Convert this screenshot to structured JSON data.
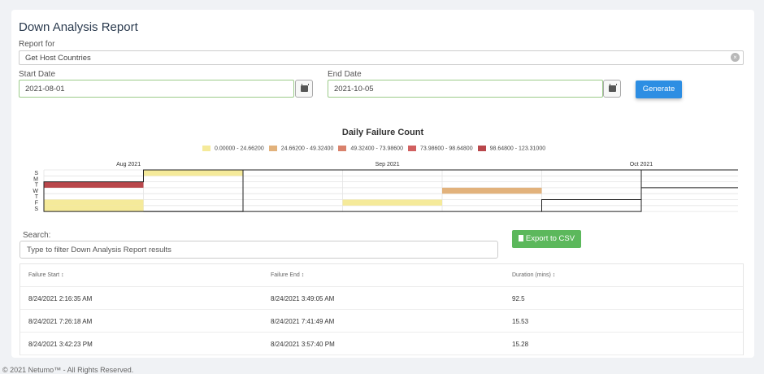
{
  "page": {
    "title": "Down Analysis Report"
  },
  "report_for": {
    "label": "Report for",
    "value": "Get Host Countries",
    "clear_icon": "times-circle-icon"
  },
  "start_date": {
    "label": "Start Date",
    "value": "2021-08-01"
  },
  "end_date": {
    "label": "End Date",
    "value": "2021-10-05"
  },
  "generate": {
    "label": "Generate"
  },
  "chart_data": {
    "type": "heatmap",
    "title": "Daily Failure Count",
    "legend": [
      {
        "label": "0.00000 - 24.66200",
        "color": "#f5ea9a"
      },
      {
        "label": "24.66200 - 49.32400",
        "color": "#e2b27c"
      },
      {
        "label": "49.32400 - 73.98600",
        "color": "#d9826c"
      },
      {
        "label": "73.98600 - 98.64800",
        "color": "#d16060"
      },
      {
        "label": "98.64800 - 123.31000",
        "color": "#b9474b"
      }
    ],
    "month_labels": [
      "Aug 2021",
      "Sep 2021",
      "Oct 2021"
    ],
    "weekday_labels": [
      "S",
      "M",
      "T",
      "W",
      "T",
      "F",
      "S"
    ],
    "legend_position": "top-center",
    "cells": [
      {
        "week": 0,
        "day": 2,
        "bin": 4
      },
      {
        "week": 0,
        "day": 5,
        "bin": 0
      },
      {
        "week": 0,
        "day": 6,
        "bin": 0
      },
      {
        "week": 1,
        "day": 0,
        "bin": 0
      },
      {
        "week": 3,
        "day": 5,
        "bin": 0
      },
      {
        "week": 4,
        "day": 3,
        "bin": 1
      }
    ]
  },
  "search": {
    "label": "Search:",
    "placeholder": "Type to filter Down Analysis Report results"
  },
  "export": {
    "label": "Export to CSV",
    "icon": "file-icon"
  },
  "table": {
    "headers": [
      "Failure Start ↕",
      "Failure End ↕",
      "Duration (mins) ↕"
    ],
    "rows": [
      [
        "8/24/2021 2:16:35 AM",
        "8/24/2021 3:49:05 AM",
        "92.5"
      ],
      [
        "8/24/2021 7:26:18 AM",
        "8/24/2021 7:41:49 AM",
        "15.53"
      ],
      [
        "8/24/2021 3:42:23 PM",
        "8/24/2021 3:57:40 PM",
        "15.28"
      ]
    ]
  },
  "footer": {
    "text": "© 2021 Netumo™ - All Rights Reserved."
  }
}
